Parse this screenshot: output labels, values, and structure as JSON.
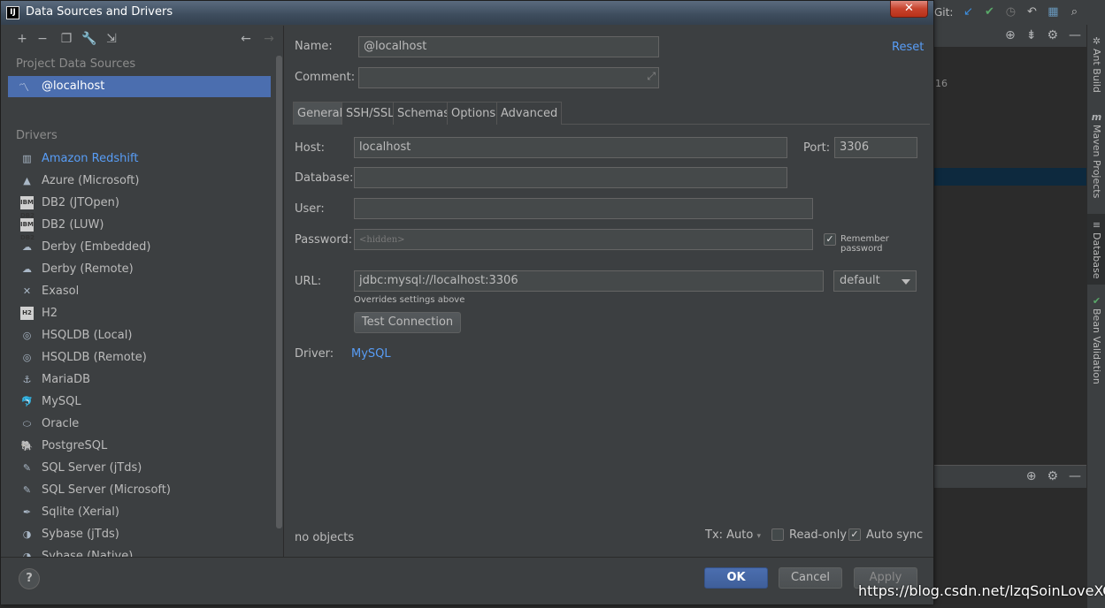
{
  "ide": {
    "tabs": [
      "",
      "",
      "",
      "",
      ""
    ],
    "git_label": "Git:",
    "panel_number": "16",
    "right_tabs": [
      {
        "icon": "ant",
        "label": "Ant Build"
      },
      {
        "icon": "m",
        "label": "Maven Projects"
      },
      {
        "icon": "db",
        "label": "Database"
      },
      {
        "icon": "bean",
        "label": "Bean Validation"
      }
    ]
  },
  "dialog": {
    "title": "Data Sources and Drivers",
    "close_glyph": "✕"
  },
  "left": {
    "project_section": "Project Data Sources",
    "data_source": "@localhost",
    "drivers_section": "Drivers",
    "drivers": [
      {
        "label": "Amazon Redshift",
        "icon": "redshift-icon",
        "glyph": "▥",
        "highlight": true
      },
      {
        "label": "Azure (Microsoft)",
        "icon": "azure-icon",
        "glyph": "▲"
      },
      {
        "label": "DB2 (JTOpen)",
        "icon": "ibm-db2-icon",
        "glyph": "IBM DB2",
        "box": true
      },
      {
        "label": "DB2 (LUW)",
        "icon": "ibm-db2-icon",
        "glyph": "IBM DB2",
        "box": true
      },
      {
        "label": "Derby (Embedded)",
        "icon": "derby-icon",
        "glyph": "☁"
      },
      {
        "label": "Derby (Remote)",
        "icon": "derby-icon",
        "glyph": "☁"
      },
      {
        "label": "Exasol",
        "icon": "exasol-icon",
        "glyph": "✕"
      },
      {
        "label": "H2",
        "icon": "h2-icon",
        "glyph": "H2",
        "box": true
      },
      {
        "label": "HSQLDB (Local)",
        "icon": "hsqldb-icon",
        "glyph": "◎"
      },
      {
        "label": "HSQLDB (Remote)",
        "icon": "hsqldb-icon",
        "glyph": "◎"
      },
      {
        "label": "MariaDB",
        "icon": "mariadb-icon",
        "glyph": "⚓"
      },
      {
        "label": "MySQL",
        "icon": "mysql-icon",
        "glyph": "🐬"
      },
      {
        "label": "Oracle",
        "icon": "oracle-icon",
        "glyph": "⬭"
      },
      {
        "label": "PostgreSQL",
        "icon": "postgresql-icon",
        "glyph": "🐘"
      },
      {
        "label": "SQL Server (jTds)",
        "icon": "sqlserver-icon",
        "glyph": "✎"
      },
      {
        "label": "SQL Server (Microsoft)",
        "icon": "sqlserver-icon",
        "glyph": "✎"
      },
      {
        "label": "Sqlite (Xerial)",
        "icon": "sqlite-icon",
        "glyph": "✒"
      },
      {
        "label": "Sybase (jTds)",
        "icon": "sybase-icon",
        "glyph": "◑"
      },
      {
        "label": "Sybase (Native)",
        "icon": "sybase-icon",
        "glyph": "◑"
      }
    ]
  },
  "form": {
    "name_label": "Name:",
    "name_value": "@localhost",
    "reset": "Reset",
    "comment_label": "Comment:",
    "comment_value": "",
    "tabs": [
      "General",
      "SSH/SSL",
      "Schemas",
      "Options",
      "Advanced"
    ],
    "host_label": "Host:",
    "host_value": "localhost",
    "port_label": "Port:",
    "port_value": "3306",
    "database_label": "Database:",
    "database_value": "",
    "user_label": "User:",
    "user_value": "",
    "password_label": "Password:",
    "password_placeholder": "<hidden>",
    "remember_password": "Remember password",
    "remember_checked": true,
    "url_label": "URL:",
    "url_value": "jdbc:mysql://localhost:3306",
    "url_mode": "default",
    "url_hint": "Overrides settings above",
    "test_connection": "Test Connection",
    "driver_label": "Driver:",
    "driver_value": "MySQL",
    "status": "no objects",
    "tx_label": "Tx: Auto",
    "readonly_label": "Read-only",
    "readonly_checked": false,
    "autosync_label": "Auto sync",
    "autosync_checked": true
  },
  "footer": {
    "help": "?",
    "ok": "OK",
    "cancel": "Cancel",
    "apply": "Apply"
  },
  "watermark": "https://blog.csdn.net/lzqSoinLoveXCC",
  "colors": {
    "accent": "#4b6eaf",
    "link": "#589df6",
    "background": "#3c3f41",
    "close": "#c7432d"
  }
}
